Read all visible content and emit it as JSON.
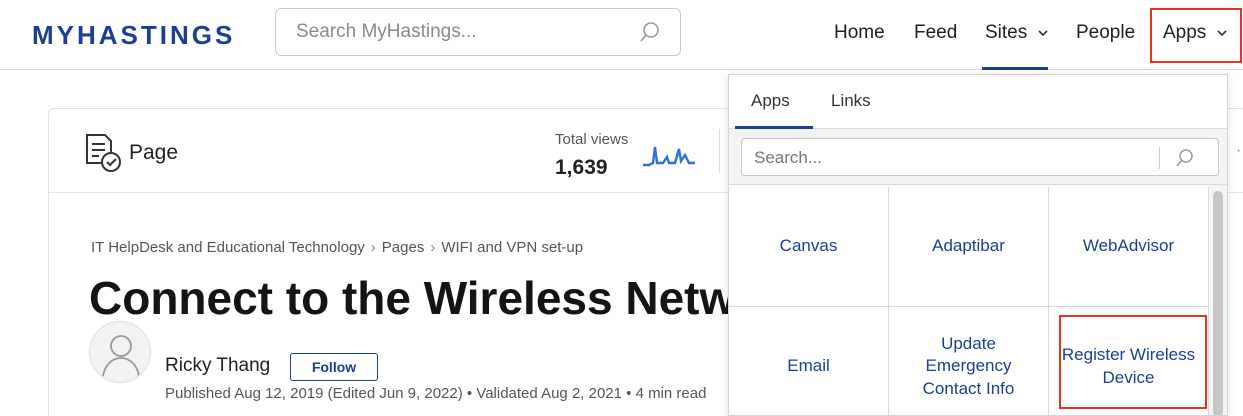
{
  "header": {
    "logo": "MYHASTINGS",
    "search_placeholder": "Search MyHastings...",
    "nav": {
      "home": "Home",
      "feed": "Feed",
      "sites": "Sites",
      "people": "People",
      "apps": "Apps"
    }
  },
  "page": {
    "type_label": "Page",
    "total_views_label": "Total views",
    "total_views_value": "1,639",
    "breadcrumb": [
      "IT HelpDesk and Educational Technology",
      "Pages",
      "WIFI and VPN set-up"
    ],
    "title": "Connect to the Wireless Netw",
    "author": "Ricky Thang",
    "follow_label": "Follow",
    "meta": "Published Aug 12, 2019 (Edited Jun 9, 2022) • Validated Aug 2, 2021 • 4 min read"
  },
  "apps_dropdown": {
    "tabs": [
      "Apps",
      "Links"
    ],
    "active_tab": "Apps",
    "search_placeholder": "Search...",
    "apps": [
      "Canvas",
      "Adaptibar",
      "WebAdvisor",
      "Email",
      "Update Emergency Contact Info",
      "Register Wireless Device"
    ]
  },
  "colors": {
    "accent": "#1c3f94",
    "highlight": "#e8321f",
    "sparkline": "#2f6fd6"
  }
}
